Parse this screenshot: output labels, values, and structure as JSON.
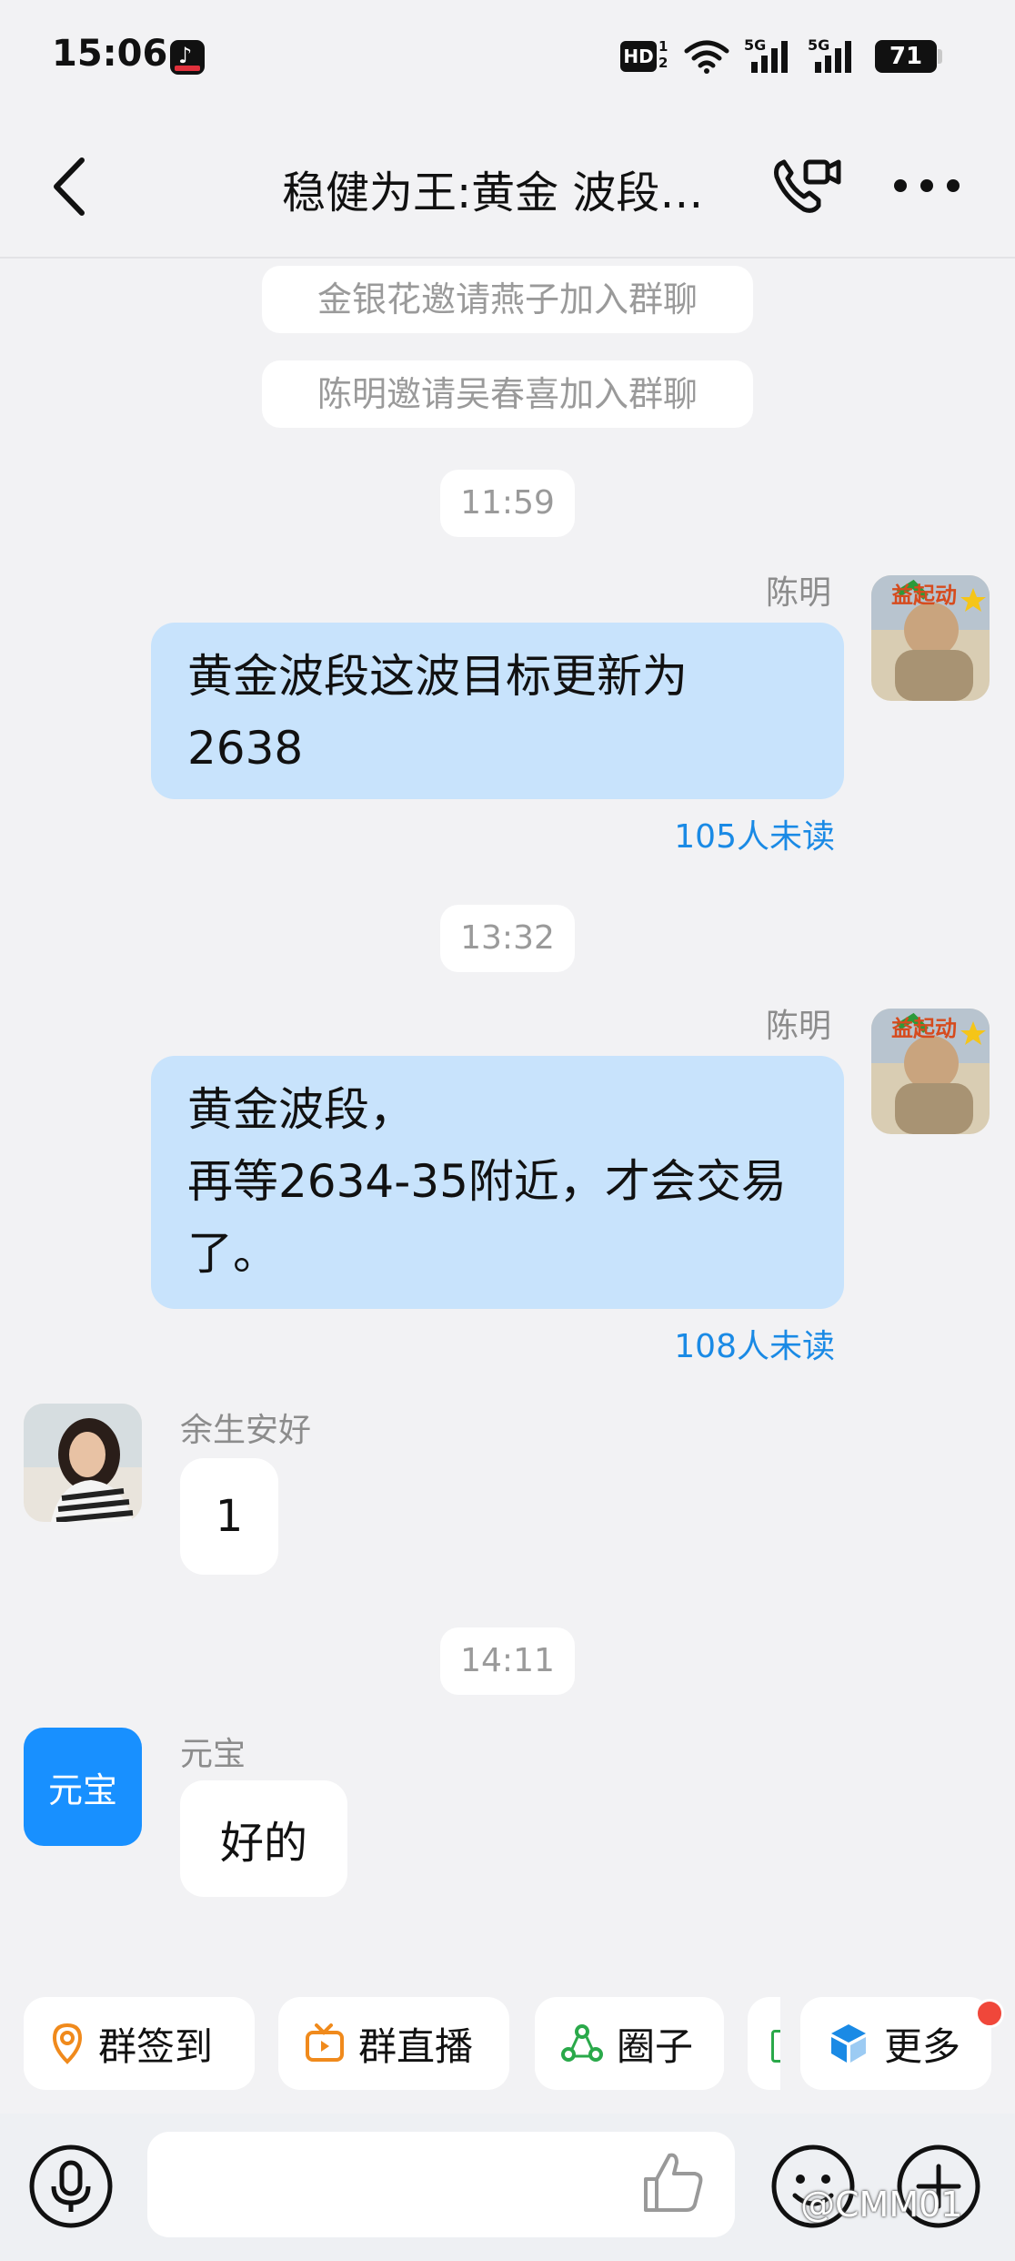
{
  "status_bar": {
    "time": "15:06",
    "hd_label": "HD",
    "hd_sub": "1\n2",
    "network_1": "5G",
    "network_2": "5G",
    "battery": "71"
  },
  "header": {
    "title": "稳健为王:黄金 波段…",
    "back_icon": "chevron-left-icon",
    "call_icon": "video-call-icon",
    "more_icon": "more-dots-icon"
  },
  "system_messages": [
    "金银花邀请燕子加入群聊",
    "陈明邀请吴春喜加入群聊"
  ],
  "timestamps": [
    "11:59",
    "13:32",
    "14:11"
  ],
  "messages": [
    {
      "sender": "陈明",
      "lines": [
        "黄金波段这波目标更新为",
        "2638"
      ],
      "unread": "105人未读",
      "avatar_badge": "益起动"
    },
    {
      "sender": "陈明",
      "lines": [
        "黄金波段，",
        "再等2634-35附近，才会交易",
        "了。"
      ],
      "unread": "108人未读",
      "avatar_badge": "益起动"
    },
    {
      "sender": "余生安好",
      "text": "1"
    },
    {
      "sender": "元宝",
      "text": "好的",
      "avatar_text": "元宝"
    }
  ],
  "quick_actions": [
    {
      "label": "群签到",
      "icon": "location-pin-icon",
      "color": "#f08a1c"
    },
    {
      "label": "群直播",
      "icon": "tv-live-icon",
      "color": "#f08a1c"
    },
    {
      "label": "圈子",
      "icon": "circle-nodes-icon",
      "color": "#2aa94a"
    },
    {
      "label": "更多",
      "icon": "cube-icon",
      "color": "#1a8ae5"
    }
  ],
  "input": {
    "placeholder": ""
  },
  "watermark": "@CMM01",
  "colors": {
    "outgoing_bubble": "#c8e3fc",
    "unread_text": "#1a8ae5",
    "background": "#f2f2f4",
    "notification_dot": "#f0473a",
    "yuanbao_avatar": "#1890ff"
  }
}
